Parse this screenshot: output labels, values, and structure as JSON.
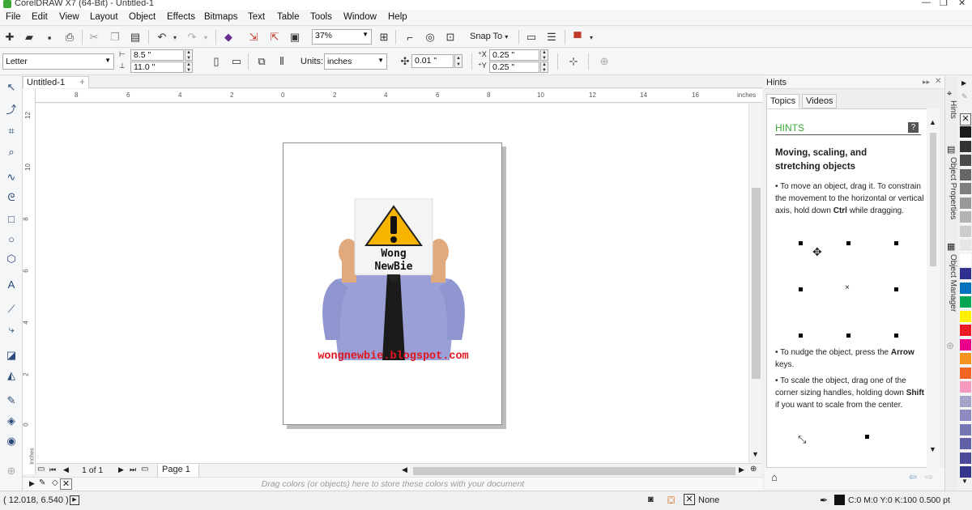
{
  "window": {
    "title": "CorelDRAW X7 (64-Bit) - Untitled-1"
  },
  "menu": [
    "File",
    "Edit",
    "View",
    "Layout",
    "Object",
    "Effects",
    "Bitmaps",
    "Text",
    "Table",
    "Tools",
    "Window",
    "Help"
  ],
  "standard_toolbar": {
    "zoom": "37%",
    "snap_to": "Snap To"
  },
  "property_bar": {
    "page_size": "Letter",
    "width": "8.5 \"",
    "height": "11.0 \"",
    "units_label": "Units:",
    "units": "inches",
    "nudge": "0.01 \"",
    "dup_x": "0.25 \"",
    "dup_y": "0.25 \""
  },
  "document": {
    "tab": "Untitled-1",
    "ruler_units": "inches",
    "hruler_ticks": [
      "8",
      "6",
      "4",
      "2",
      "0",
      "2",
      "4",
      "6",
      "8",
      "10",
      "12",
      "14",
      "16"
    ],
    "vruler_ticks": [
      "12",
      "10",
      "8",
      "6",
      "4",
      "2",
      "0"
    ],
    "artwork": {
      "sign_line1": "Wong",
      "sign_line2": "NewBie",
      "url": "wongnewbie.blogspot.com"
    },
    "page_nav": {
      "count": "1 of 1",
      "page_tab": "Page 1"
    },
    "palette_hint": "Drag colors (or objects) here to store these colors with your document"
  },
  "status": {
    "coords": "( 12.018, 6.540 )",
    "fill_none": "None",
    "outline": "C:0 M:0 Y:0 K:100  0.500 pt"
  },
  "hints": {
    "panel_title": "Hints",
    "tabs": [
      "Topics",
      "Videos"
    ],
    "header": "HINTS",
    "heading_line1": "Moving, scaling, and",
    "heading_line2": "stretching objects",
    "p1": "To move an object, drag it. To constrain the movement to the horizontal or vertical axis, hold down",
    "p1_bold": "Ctrl",
    "p1_end": "while dragging.",
    "p2": "To nudge the object, press the",
    "p2_bold": "Arrow",
    "p2_end": "keys.",
    "p3": "To scale the object, drag one of the corner sizing handles, holding down",
    "p3_bold": "Shift",
    "p3_end": "if you want to scale from the center."
  },
  "side_tabs": [
    "Hints",
    "Object Properties",
    "Object Manager"
  ],
  "palette_colors": [
    "#1a1a1a",
    "#333333",
    "#4d4d4d",
    "#666666",
    "#808080",
    "#999999",
    "#b3b3b3",
    "#cccccc",
    "#e6e6e6",
    "#ffffff",
    "#2e3192",
    "#0071bc",
    "#00a651",
    "#fff200",
    "#ed1c24",
    "#ec008c",
    "#f7941d",
    "#f26522",
    "#f49ac1",
    "#a3a3cc",
    "#8c8cc0",
    "#7676b3",
    "#6060a6",
    "#4b4b99",
    "#35358c"
  ],
  "colors": {
    "url_red": "#e4151f",
    "warning_yellow": "#f6b400",
    "shirt": "#9aa0d6"
  }
}
